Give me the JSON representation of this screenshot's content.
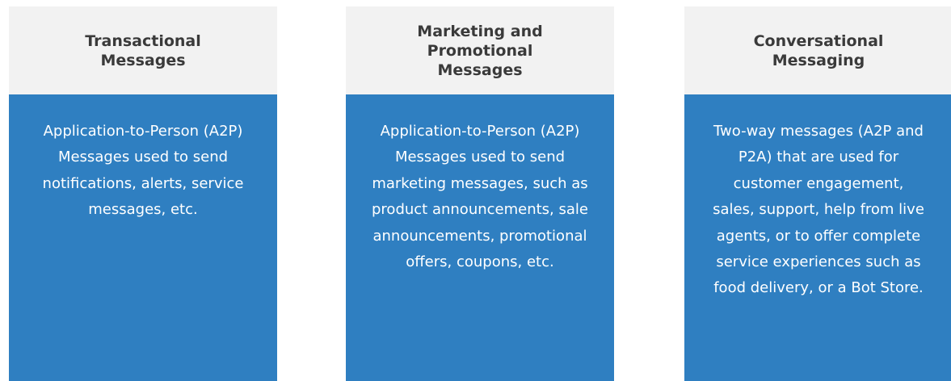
{
  "cards": [
    {
      "title": "Transactional Messages",
      "description": "Application-to-Person (A2P) Messages used to send notifications, alerts, service messages, etc."
    },
    {
      "title": "Marketing and Promotional Messages",
      "description": "Application-to-Person (A2P) Messages used to send marketing messages, such as product announcements, sale announcements, promotional offers, coupons, etc."
    },
    {
      "title": "Conversational Messaging",
      "description": "Two-way messages (A2P and P2A) that are used for customer engagement, sales, support, help from live agents, or to offer complete service experiences such as food delivery, or a Bot Store."
    }
  ],
  "colors": {
    "header_background": "#f2f2f2",
    "body_background": "#2f7fc1",
    "title_text": "#3a3a3a",
    "body_text": "#ffffff"
  }
}
